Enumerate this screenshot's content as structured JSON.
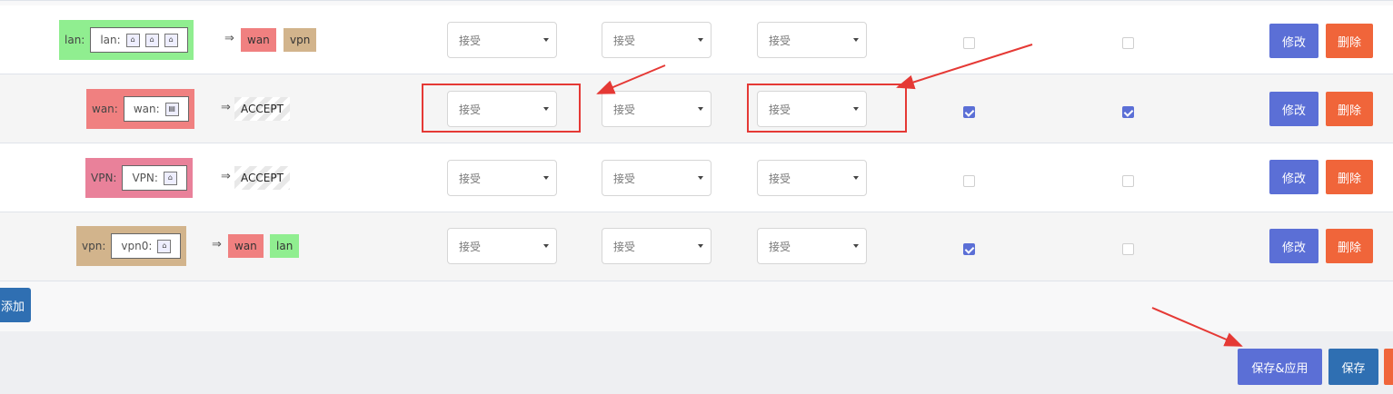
{
  "labels": {
    "accept_option": "接受",
    "accept_tag": "ACCEPT",
    "forward_arrow": "⇒",
    "edit": "修改",
    "delete": "删除"
  },
  "rows": [
    {
      "zone_name": "lan:",
      "iface_text": "lan:",
      "forward_tags": [
        "wan",
        "vpn"
      ],
      "input": "接受",
      "output": "接受",
      "forward": "接受",
      "masquerade": false,
      "mss_clamping": false
    },
    {
      "zone_name": "wan:",
      "iface_text": "wan:",
      "forward_tags": [
        "ACCEPT"
      ],
      "input": "接受",
      "output": "接受",
      "forward": "接受",
      "masquerade": true,
      "mss_clamping": true
    },
    {
      "zone_name": "VPN:",
      "iface_text": "VPN:",
      "forward_tags": [
        "ACCEPT"
      ],
      "input": "接受",
      "output": "接受",
      "forward": "接受",
      "masquerade": false,
      "mss_clamping": false
    },
    {
      "zone_name": "vpn:",
      "iface_text": "vpn0:",
      "forward_tags": [
        "wan",
        "lan"
      ],
      "input": "接受",
      "output": "接受",
      "forward": "接受",
      "masquerade": true,
      "mss_clamping": false
    }
  ],
  "add_button": "添加",
  "footer": {
    "save_apply": "保存&应用",
    "save": "保存"
  },
  "colors": {
    "lan": "#90ee90",
    "wan": "#f08080",
    "vpn_zone": "#e9819a",
    "vpn": "#d2b48c",
    "edit": "#5b6fd6",
    "delete": "#f0653a",
    "save": "#2f6fb2",
    "highlight": "#e53935"
  },
  "icons": [
    "network-port-icon",
    "multi-port-icon",
    "checkmark-icon",
    "dropdown-caret-icon"
  ]
}
